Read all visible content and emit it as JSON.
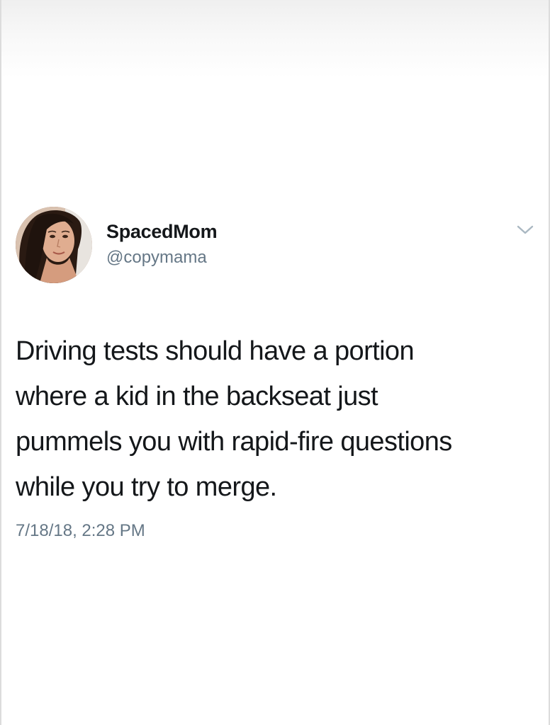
{
  "tweet": {
    "author": {
      "display_name": "SpacedMom",
      "handle": "@copymama",
      "avatar_icon": "profile-photo"
    },
    "menu_icon": "chevron-down-icon",
    "text_lines": [
      "Driving tests should have a portion",
      "where a kid in the backseat just",
      "pummels you with rapid-fire questions",
      "while you try to merge."
    ],
    "timestamp": "7/18/18, 2:28 PM"
  },
  "colors": {
    "primary_text": "#14171a",
    "secondary_text": "#657786",
    "chevron": "#aab8c2"
  }
}
